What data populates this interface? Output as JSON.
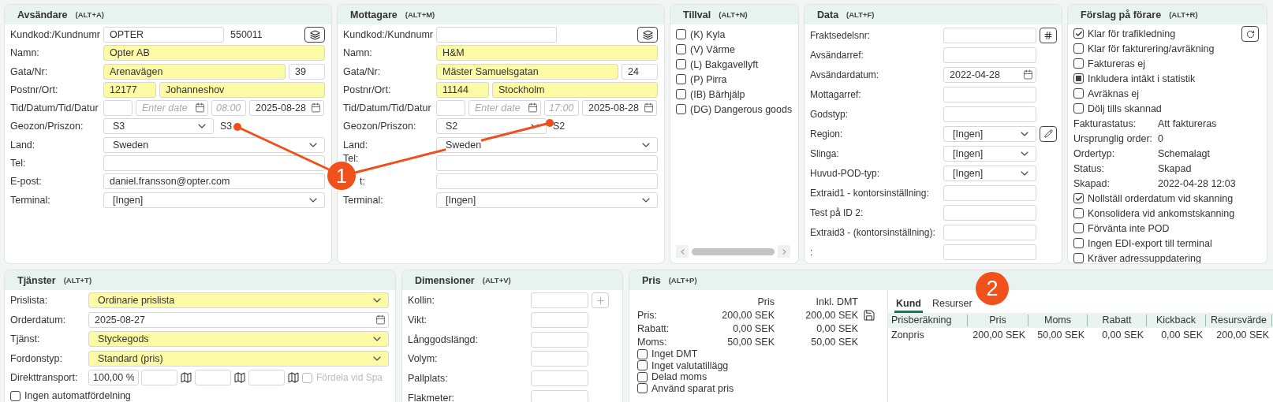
{
  "sender": {
    "title": "Avsändare",
    "shortcut": "(ALT+A)",
    "customer": {
      "label": "Kundkod:/Kundnumr",
      "code": "OPTER",
      "number": "550011"
    },
    "name": {
      "label": "Namn:",
      "value": "Opter AB",
      "highlighted": true
    },
    "street": {
      "label": "Gata/Nr:",
      "value": "Arenavägen",
      "number": "39",
      "highlighted": true
    },
    "postal": {
      "label": "Postnr/Ort:",
      "zip": "12177",
      "city": "Johanneshov",
      "highlighted": true
    },
    "times": {
      "label": "Tid/Datum/Tid/Datur",
      "date_from": {
        "placeholder": "Enter date"
      },
      "time_to": {
        "placeholder": "08:00"
      },
      "date_to": {
        "value": "2025-08-28"
      }
    },
    "zone": {
      "label": "Geozon/Priszon:",
      "geozone": "S3",
      "pricezone": "S3"
    },
    "country": {
      "label": "Land:",
      "value": "Sweden"
    },
    "phone": {
      "label": "Tel:"
    },
    "email": {
      "label": "E-post:",
      "value": "daniel.fransson@opter.com"
    },
    "terminal": {
      "label": "Terminal:",
      "value": "[Ingen]"
    }
  },
  "receiver": {
    "title": "Mottagare",
    "shortcut": "(ALT+M)",
    "customer": {
      "label": "Kundkod:/Kundnumr"
    },
    "name": {
      "label": "Namn:",
      "value": "H&M",
      "highlighted": true
    },
    "street": {
      "label": "Gata/Nr:",
      "value": "Mäster Samuelsgatan",
      "number": "24",
      "highlighted": true
    },
    "postal": {
      "label": "Postnr/Ort:",
      "zip": "11144",
      "city": "Stockholm",
      "highlighted": true
    },
    "times": {
      "label": "Tid/Datum/Tid/Datur",
      "date_from": {
        "placeholder": "Enter date"
      },
      "time_to": {
        "placeholder": "17:00"
      },
      "date_to": {
        "value": "2025-08-28"
      }
    },
    "zone": {
      "label": "Geozon/Priszon:",
      "geozone": "S2",
      "pricezone": "S2"
    },
    "country": {
      "label": "Land:",
      "value": "Sweden"
    },
    "phone": {
      "label": "Tel:"
    },
    "email": {
      "label": "t:"
    },
    "terminal": {
      "label": "Terminal:",
      "value": "[Ingen]"
    }
  },
  "extras": {
    "title": "Tillval",
    "shortcut": "(ALT+N)",
    "options": [
      {
        "label": "(K) Kyla",
        "checked": false
      },
      {
        "label": "(V) Värme",
        "checked": false
      },
      {
        "label": "(L) Bakgavellyft",
        "checked": false
      },
      {
        "label": "(P) Pirra",
        "checked": false
      },
      {
        "label": "(IB) Bärhjälp",
        "checked": false
      },
      {
        "label": "(DG) Dangerous goods",
        "checked": false
      }
    ]
  },
  "data": {
    "title": "Data",
    "shortcut": "(ALT+F)",
    "fields": [
      {
        "label": "Fraktsedelsnr:",
        "kind": "text",
        "button": true
      },
      {
        "label": "Avsändarref:",
        "kind": "text"
      },
      {
        "label": "Avsändardatum:",
        "kind": "date",
        "value": "2022-04-28"
      },
      {
        "label": "Mottagarref:",
        "kind": "text"
      },
      {
        "label": "Godstyp:",
        "kind": "text"
      },
      {
        "label": "Region:",
        "kind": "select",
        "value": "[Ingen]",
        "button": true
      },
      {
        "label": "Slinga:",
        "kind": "select",
        "value": "[Ingen]"
      },
      {
        "label": "Huvud-POD-typ:",
        "kind": "select",
        "value": "[Ingen]"
      },
      {
        "label": "Extraid1 - kontorsinställning:",
        "kind": "text"
      },
      {
        "label": "Test på ID 2:",
        "kind": "text"
      },
      {
        "label": "Extraid3 - (kontorsinställning):",
        "kind": "text"
      },
      {
        "label": ":",
        "kind": "text"
      }
    ]
  },
  "driver": {
    "title": "Förslag på förare",
    "shortcut": "(ALT+R)",
    "items": [
      {
        "kind": "checkbox",
        "label": "Klar för trafikledning",
        "checked": true,
        "indeterminate": false
      },
      {
        "kind": "checkbox",
        "label": "Klar för fakturering/avräkning",
        "checked": false,
        "indeterminate": false
      },
      {
        "kind": "checkbox",
        "label": "Faktureras ej",
        "checked": false,
        "indeterminate": false
      },
      {
        "kind": "checkbox",
        "label": "Inkludera intäkt i statistik",
        "checked": false,
        "indeterminate": true
      },
      {
        "kind": "checkbox",
        "label": "Avräknas ej",
        "checked": false,
        "indeterminate": false
      },
      {
        "kind": "checkbox",
        "label": "Dölj tills skannad",
        "checked": false,
        "indeterminate": false
      },
      {
        "kind": "info",
        "label": "Fakturastatus:",
        "value": "Att faktureras"
      },
      {
        "kind": "info",
        "label": "Ursprunglig order:",
        "value": "0"
      },
      {
        "kind": "info",
        "label": "Ordertyp:",
        "value": "Schemalagt"
      },
      {
        "kind": "info",
        "label": "Status:",
        "value": "Skapad"
      },
      {
        "kind": "info",
        "label": "Skapad:",
        "value": "2022-04-28 12:03"
      },
      {
        "kind": "checkbox",
        "label": "Nollställ orderdatum vid skanning",
        "checked": true,
        "indeterminate": false
      },
      {
        "kind": "checkbox",
        "label": "Konsolidera vid ankomstskanning",
        "checked": false,
        "indeterminate": false
      },
      {
        "kind": "checkbox",
        "label": "Förvänta inte POD",
        "checked": false,
        "indeterminate": false
      },
      {
        "kind": "checkbox",
        "label": "Ingen EDI-export till terminal",
        "checked": false,
        "indeterminate": false
      },
      {
        "kind": "checkbox",
        "label": "Kräver adressuppdatering",
        "checked": false,
        "indeterminate": false
      }
    ]
  },
  "services": {
    "title": "Tjänster",
    "shortcut": "(ALT+T)",
    "rows": [
      {
        "kind": "select",
        "label": "Prislista:",
        "value": "Ordinarie prislista",
        "highlighted": true
      },
      {
        "kind": "date",
        "label": "Orderdatum:",
        "value": "2025-08-27",
        "highlighted": false
      },
      {
        "kind": "select",
        "label": "Tjänst:",
        "value": "Styckegods",
        "highlighted": true
      },
      {
        "kind": "select",
        "label": "Fordonstyp:",
        "value": "Standard (pris)",
        "highlighted": true
      }
    ],
    "direct": {
      "label": "Direkttransport:",
      "percent": "100,00 %",
      "distribute": {
        "label": "Fördela vid Spa",
        "checked": false,
        "disabled": true
      }
    },
    "auto": {
      "label": "Ingen automatfördelning",
      "checked": false
    }
  },
  "dimensions": {
    "title": "Dimensioner",
    "shortcut": "(ALT+V)",
    "fields": [
      {
        "label": "Kollin:",
        "add_button": true
      },
      {
        "label": "Vikt:"
      },
      {
        "label": "Långgodslängd:"
      },
      {
        "label": "Volym:"
      },
      {
        "label": "Pallplats:"
      },
      {
        "label": "Flakmeter:"
      }
    ]
  },
  "price": {
    "title": "Pris",
    "shortcut": "(ALT+P)",
    "columns": [
      "Pris",
      "Inkl. DMT"
    ],
    "rows": [
      {
        "label": "Pris:",
        "price": "200,00 SEK",
        "incl": "200,00 SEK"
      },
      {
        "label": "Rabatt:",
        "price": "0,00 SEK",
        "incl": "0,00 SEK"
      },
      {
        "label": "Moms:",
        "price": "50,00 SEK",
        "incl": "50,00 SEK"
      }
    ],
    "options": [
      {
        "label": "Inget DMT",
        "checked": false
      },
      {
        "label": "Inget valutatillägg",
        "checked": false
      },
      {
        "label": "Delad moms",
        "checked": false
      },
      {
        "label": "Använd sparat pris",
        "checked": false
      }
    ],
    "tabs": [
      {
        "label": "Kund",
        "selected": true
      },
      {
        "label": "Resurser",
        "selected": false
      }
    ],
    "table": {
      "columns": [
        "Prisberäkning",
        "Pris",
        "Moms",
        "Rabatt",
        "Kickback",
        "Resursvärde"
      ],
      "rows": [
        [
          "Zonpris",
          "200,00 SEK",
          "50,00 SEK",
          "0,00 SEK",
          "0,00 SEK",
          "200,00 SEK"
        ]
      ]
    }
  },
  "annotations": [
    {
      "label": "1"
    },
    {
      "label": "2"
    }
  ]
}
